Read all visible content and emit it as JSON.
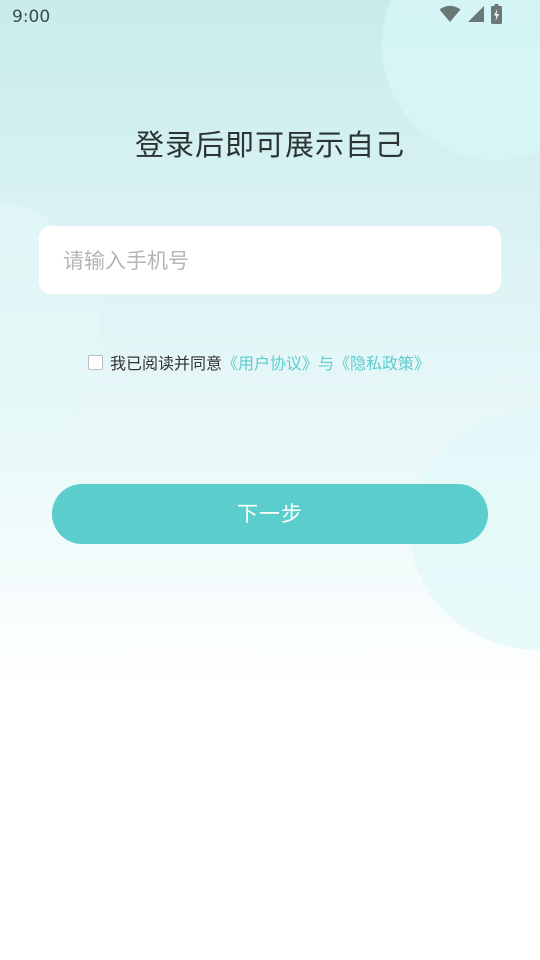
{
  "status_bar": {
    "time": "9:00",
    "icons": [
      "wifi-icon",
      "cellular-signal-icon",
      "battery-charging-icon"
    ]
  },
  "login": {
    "title": "登录后即可展示自己",
    "phone_placeholder": "请输入手机号",
    "phone_value": "",
    "agreement": {
      "checked": false,
      "prefix": "我已阅读并同意",
      "user_agreement_link": "《用户协议》",
      "connector": "与",
      "privacy_policy_link": "《隐私政策》"
    },
    "next_button_label": "下一步"
  },
  "colors": {
    "accent": "#5ccdcd",
    "title_text": "#2b3333",
    "placeholder": "#b5b5b5",
    "background_top": "#c8ecec"
  }
}
